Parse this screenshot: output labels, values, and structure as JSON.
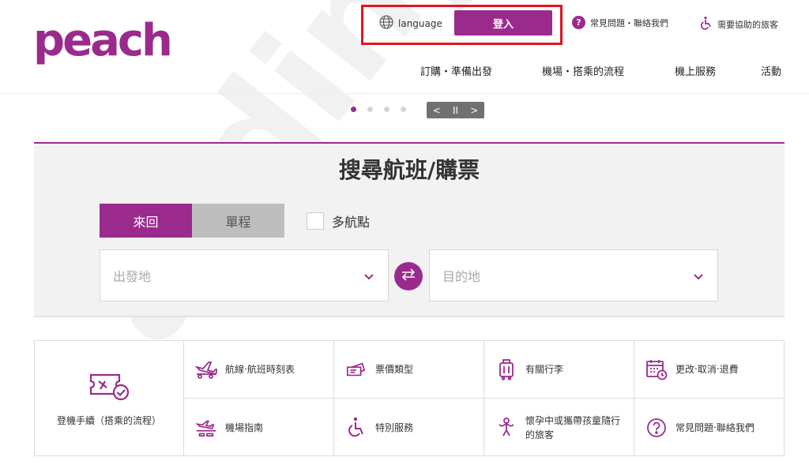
{
  "brand": {
    "logo": "peach",
    "accent": "#9b2a8d",
    "highlight": "#e0141f"
  },
  "header": {
    "language_label": "language",
    "login_label": "登入",
    "faq_label": "常見問題・聯絡我們",
    "assist_label": "需要協助的旅客",
    "nav": [
      "訂購・準備出發",
      "機場・搭乘的流程",
      "機上服務",
      "活動"
    ]
  },
  "carousel": {
    "slides": 4,
    "active": 1,
    "prev": "<",
    "pause": "II",
    "next": ">"
  },
  "search": {
    "title": "搜尋航班/購票",
    "tab_round": "來回",
    "tab_oneway": "單程",
    "multi_city": "多航點",
    "origin_placeholder": "出發地",
    "destination_placeholder": "目的地"
  },
  "quicklinks": {
    "checkin": "登機手續（搭乘的流程）",
    "items": [
      "航線‧航班時刻表",
      "票價類型",
      "有關行李",
      "更改‧取消‧退費",
      "機場指南",
      "特別服務",
      "懷孕中或攜帶孩童隨行的旅客",
      "常見問題‧聯絡我們"
    ]
  },
  "watermark": "ardingw"
}
